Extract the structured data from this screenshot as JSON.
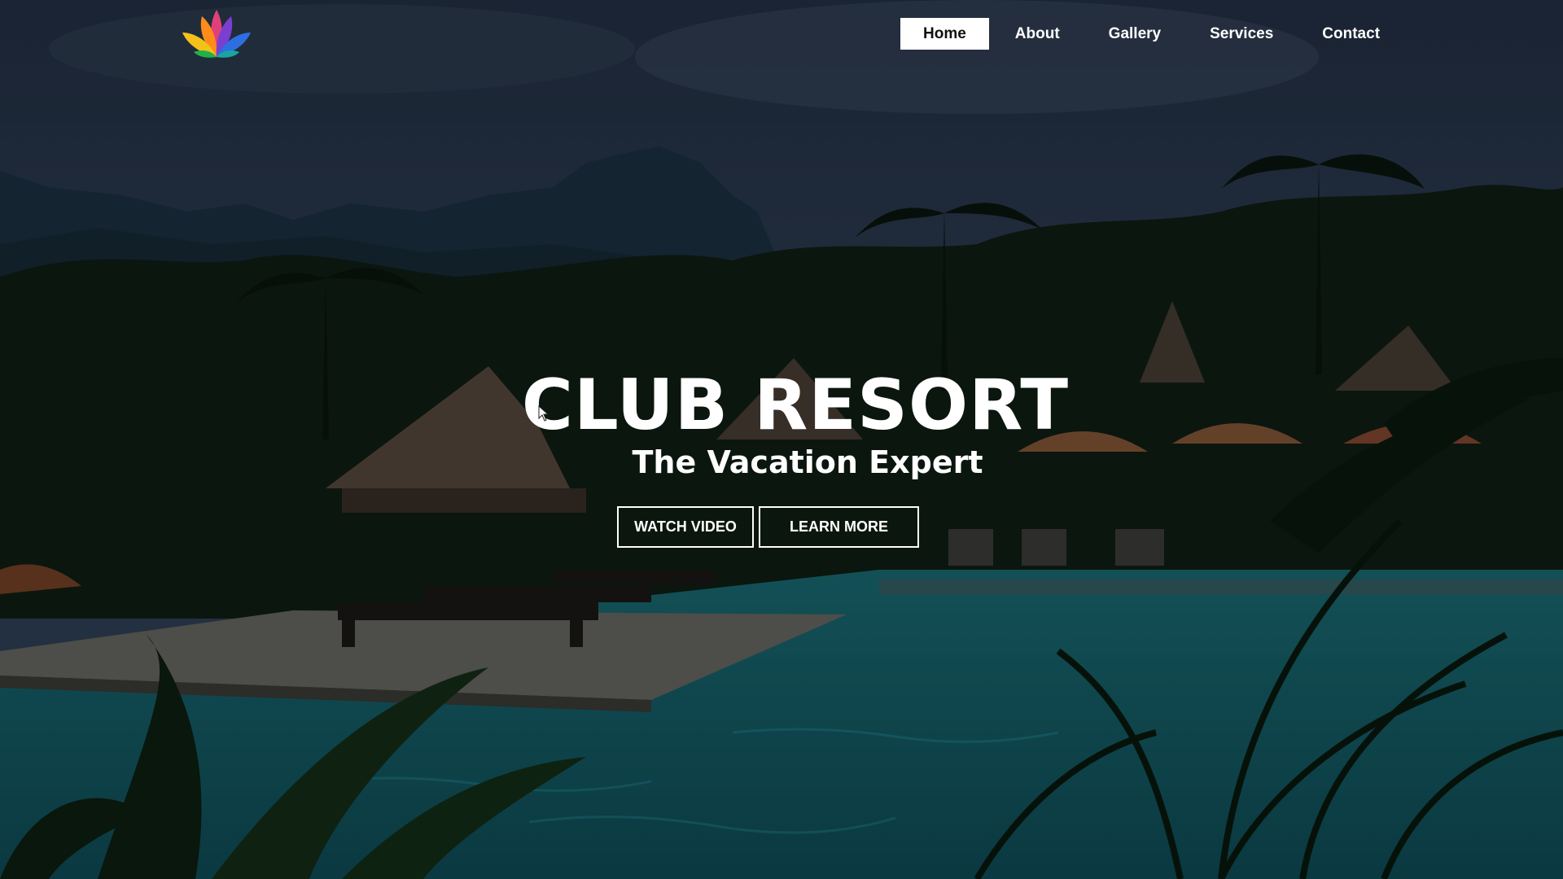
{
  "header": {
    "logo_icon": "multicolor-lotus-icon",
    "nav": [
      {
        "label": "Home",
        "active": true
      },
      {
        "label": "About",
        "active": false
      },
      {
        "label": "Gallery",
        "active": false
      },
      {
        "label": "Services",
        "active": false
      },
      {
        "label": "Contact",
        "active": false
      }
    ]
  },
  "hero": {
    "title": "CLUB RESORT",
    "subtitle": "The Vacation Expert",
    "buttons": {
      "watch_video": "WATCH VIDEO",
      "learn_more": "LEARN MORE"
    }
  },
  "colors": {
    "text": "#ffffff",
    "active_nav_bg": "#ffffff",
    "active_nav_text": "#111111",
    "pool": "#1f8a95",
    "sky": "#2b3d55"
  }
}
